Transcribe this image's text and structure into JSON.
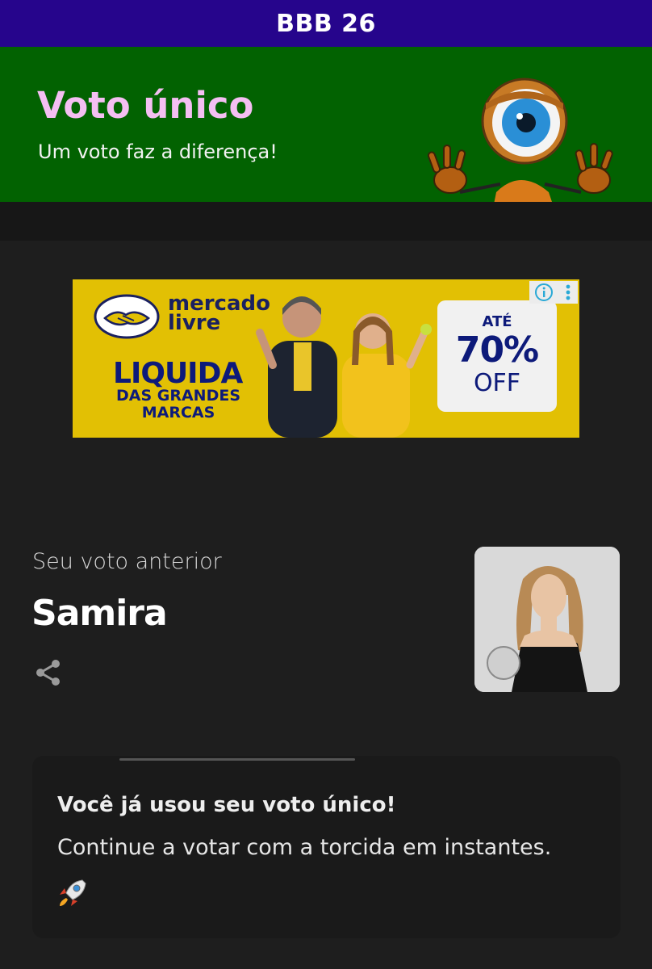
{
  "app": {
    "title": "BBB 26"
  },
  "hero": {
    "heading": "Voto único",
    "subtitle": "Um voto faz a diferença!"
  },
  "ad": {
    "brand": "mercado livre",
    "headline": "LIQUIDA",
    "subheadline": "DAS GRANDES MARCAS",
    "offer_prefix": "ATÉ",
    "offer_value": "70%",
    "offer_suffix": "OFF",
    "colors": {
      "background": "#e2c004",
      "text": "#0d1a7a"
    }
  },
  "previous_vote": {
    "label": "Seu voto anterior",
    "name": "Samira"
  },
  "notice": {
    "title": "Você já usou seu voto único!",
    "body": "Continue a votar com a torcida em instantes."
  },
  "colors": {
    "topbar": "#26058c",
    "hero": "#026201",
    "heading": "#f4bff2",
    "background": "#1e1e1e"
  }
}
